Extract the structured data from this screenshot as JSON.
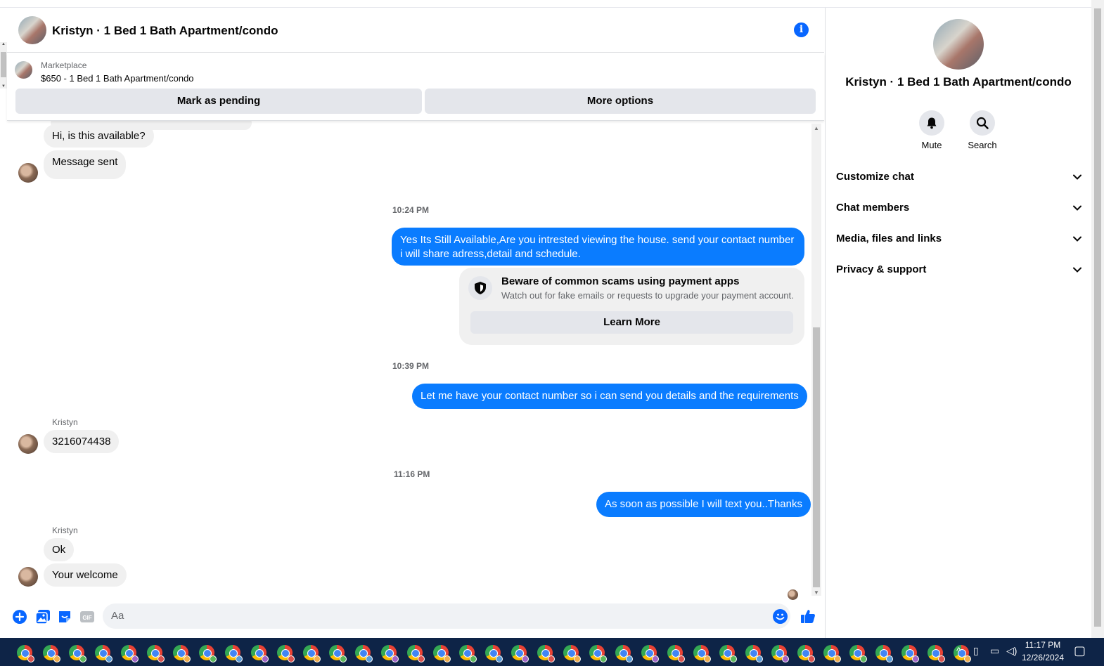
{
  "header": {
    "title": "Kristyn · 1 Bed 1 Bath Apartment/condo"
  },
  "marketplace": {
    "label": "Marketplace",
    "item": "$650 - 1 Bed 1 Bath Apartment/condo",
    "mark_pending": "Mark as pending",
    "more_options": "More options"
  },
  "messages": {
    "m1": "Hi, is this available?",
    "m2": "Message sent",
    "ts1": "10:24 PM",
    "out1": "Yes Its Still Available,Are you intrested viewing the house. send your contact number i will share adress,detail and schedule.",
    "scam_title": "Beware of common scams using payment apps",
    "scam_desc": "Watch out for fake emails or requests to upgrade your payment account.",
    "learn_more": "Learn More",
    "ts2": "10:39 PM",
    "out2": "Let me have your contact number so i can send you details and the requirements",
    "sender1": "Kristyn",
    "in_phone": "3216074438",
    "ts3": "11:16 PM",
    "out3": "As soon as possible I will text you..Thanks",
    "sender2": "Kristyn",
    "in_ok": "Ok",
    "in_welcome": "Your welcome"
  },
  "composer": {
    "placeholder": "Aa",
    "gif": "GIF"
  },
  "sidebar": {
    "title": "Kristyn · 1 Bed 1 Bath Apartment/condo",
    "mute": "Mute",
    "search": "Search",
    "rows": [
      "Customize chat",
      "Chat members",
      "Media, files and links",
      "Privacy & support"
    ]
  },
  "taskbar": {
    "time": "11:17 PM",
    "date": "12/26/2024"
  },
  "colors": {
    "accent": "#0866ff",
    "bubble_out": "#0a7cff",
    "bubble_in": "#f0f0f0",
    "taskbar": "#0e2447"
  }
}
